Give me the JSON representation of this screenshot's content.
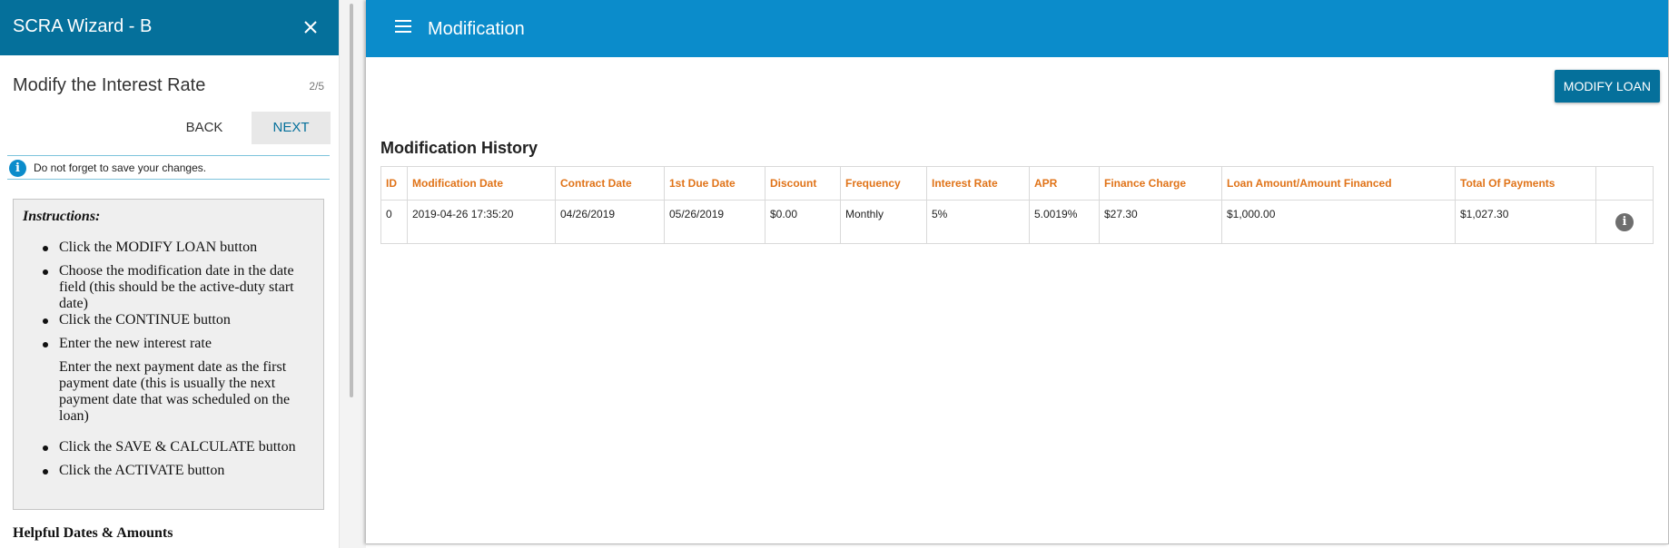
{
  "wizard": {
    "title": "SCRA Wizard - B",
    "step_title": "Modify the Interest Rate",
    "step_count": "2/5",
    "back_label": "BACK",
    "next_label": "NEXT",
    "notice": "Do not forget to save your changes.",
    "instructions_title": "Instructions:",
    "instructions": [
      "Click the MODIFY LOAN button",
      "Choose the modification date in the date field (this should be the active-duty start date)",
      "Click the CONTINUE button",
      "Enter the new interest rate",
      "Enter the next payment date as the first payment date (this is usually the next payment date that was scheduled on the loan)",
      "Click the SAVE & CALCULATE button",
      "Click the ACTIVATE button"
    ],
    "helpful_title": "Helpful Dates & Amounts"
  },
  "app": {
    "title": "Modification",
    "modify_loan_label": "MODIFY LOAN",
    "history_title": "Modification History",
    "columns": [
      "ID",
      "Modification Date",
      "Contract Date",
      "1st Due Date",
      "Discount",
      "Frequency",
      "Interest Rate",
      "APR",
      "Finance Charge",
      "Loan Amount/Amount Financed",
      "Total Of Payments",
      ""
    ],
    "rows": [
      [
        "0",
        "2019-04-26 17:35:20",
        "04/26/2019",
        "05/26/2019",
        "$0.00",
        "Monthly",
        "5%",
        "5.0019%",
        "$27.30",
        "$1,000.00",
        "$1,027.30"
      ]
    ]
  },
  "icons": {
    "close": "close-icon",
    "menu": "hamburger-menu-icon",
    "info": "info-icon"
  },
  "colors": {
    "wizard_header": "#05709b",
    "app_header": "#0b8ccb",
    "table_header_text": "#e07318",
    "button": "#05709b"
  }
}
